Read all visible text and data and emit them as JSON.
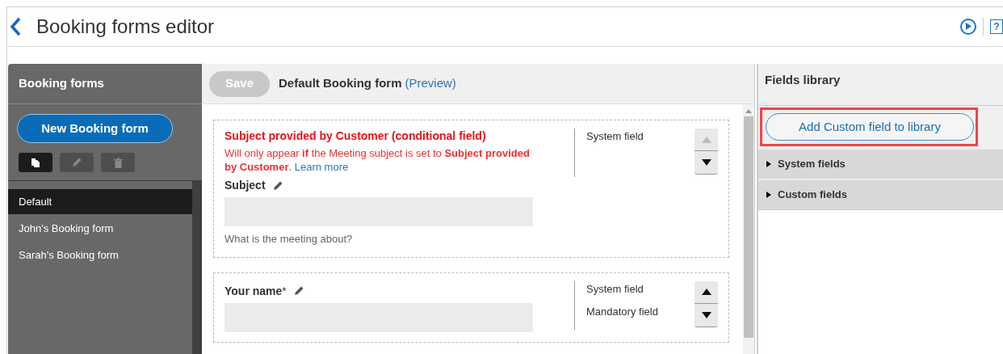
{
  "header": {
    "title": "Booking forms editor",
    "help": "?"
  },
  "sidebar": {
    "title": "Booking forms",
    "new_button": "New Booking form",
    "tools": [
      {
        "kind": "copy",
        "disabled": false
      },
      {
        "kind": "edit",
        "disabled": true
      },
      {
        "kind": "delete",
        "disabled": true
      }
    ],
    "items": [
      {
        "label": "Default",
        "selected": true
      },
      {
        "label": "John's Booking form",
        "selected": false
      },
      {
        "label": "Sarah's Booking form",
        "selected": false
      }
    ]
  },
  "editor": {
    "save": {
      "label": "Save",
      "disabled": true
    },
    "form_name": "Default Booking form",
    "preview_link": "(Preview)",
    "fields": [
      {
        "conditional_title": "Subject provided by Customer (conditional field)",
        "conditional_note": "Will only appear **if** the Meeting subject is set to **Subject provided by Customer**.",
        "learn_more": "Learn more",
        "label": "Subject",
        "help": "What is the meeting about?",
        "tags": [
          "System field"
        ],
        "up_disabled": true,
        "down_disabled": false
      },
      {
        "label": "Your name",
        "required_mark": "*",
        "tags": [
          "System field",
          "Mandatory field"
        ],
        "up_disabled": false,
        "down_disabled": false
      }
    ]
  },
  "library": {
    "title": "Fields library",
    "add_button": "Add Custom field to library",
    "highlighted": true,
    "sections": [
      {
        "label": "System fields",
        "expanded": false
      },
      {
        "label": "Custom fields",
        "expanded": false
      }
    ]
  }
}
